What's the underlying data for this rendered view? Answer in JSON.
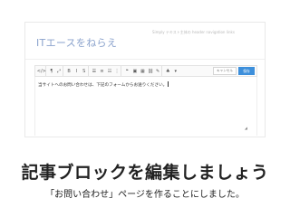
{
  "site": {
    "title": "ITエースをねらえ",
    "tagline": "Simply テキスト主体の header navigation links"
  },
  "toolbar": {
    "buttons": [
      {
        "glyph": "</>",
        "icon": "code-icon"
      },
      {
        "glyph": "¶",
        "icon": "paragraph-icon"
      },
      {
        "glyph": "⤢",
        "icon": "expand-icon"
      },
      {
        "glyph": "B",
        "icon": "bold-icon"
      },
      {
        "glyph": "I",
        "icon": "italic-icon"
      },
      {
        "glyph": "S",
        "icon": "strikethrough-icon"
      },
      {
        "glyph": "☰",
        "icon": "align-left-icon"
      },
      {
        "glyph": "≡",
        "icon": "align-center-icon"
      },
      {
        "glyph": "☷",
        "icon": "align-right-icon"
      },
      {
        "glyph": "⋮",
        "icon": "list-icon"
      },
      {
        "glyph": "❝",
        "icon": "quote-icon"
      },
      {
        "glyph": "▣",
        "icon": "image-icon"
      },
      {
        "glyph": "▦",
        "icon": "gallery-icon"
      },
      {
        "glyph": "⛓",
        "icon": "link-icon"
      },
      {
        "glyph": "✎",
        "icon": "pen-icon"
      },
      {
        "glyph": "♣",
        "icon": "plugin-icon"
      },
      {
        "glyph": "▾",
        "icon": "chevron-down-icon"
      }
    ],
    "cancel_label": "キャンセル",
    "save_label": "保存"
  },
  "editor": {
    "text": "当サイトへのお問い合わせは、下記のフォームからお送りください。"
  },
  "headline": "記事ブロックを編集しましょう",
  "caption": "「お問い合わせ」ページを作ることにしました。"
}
